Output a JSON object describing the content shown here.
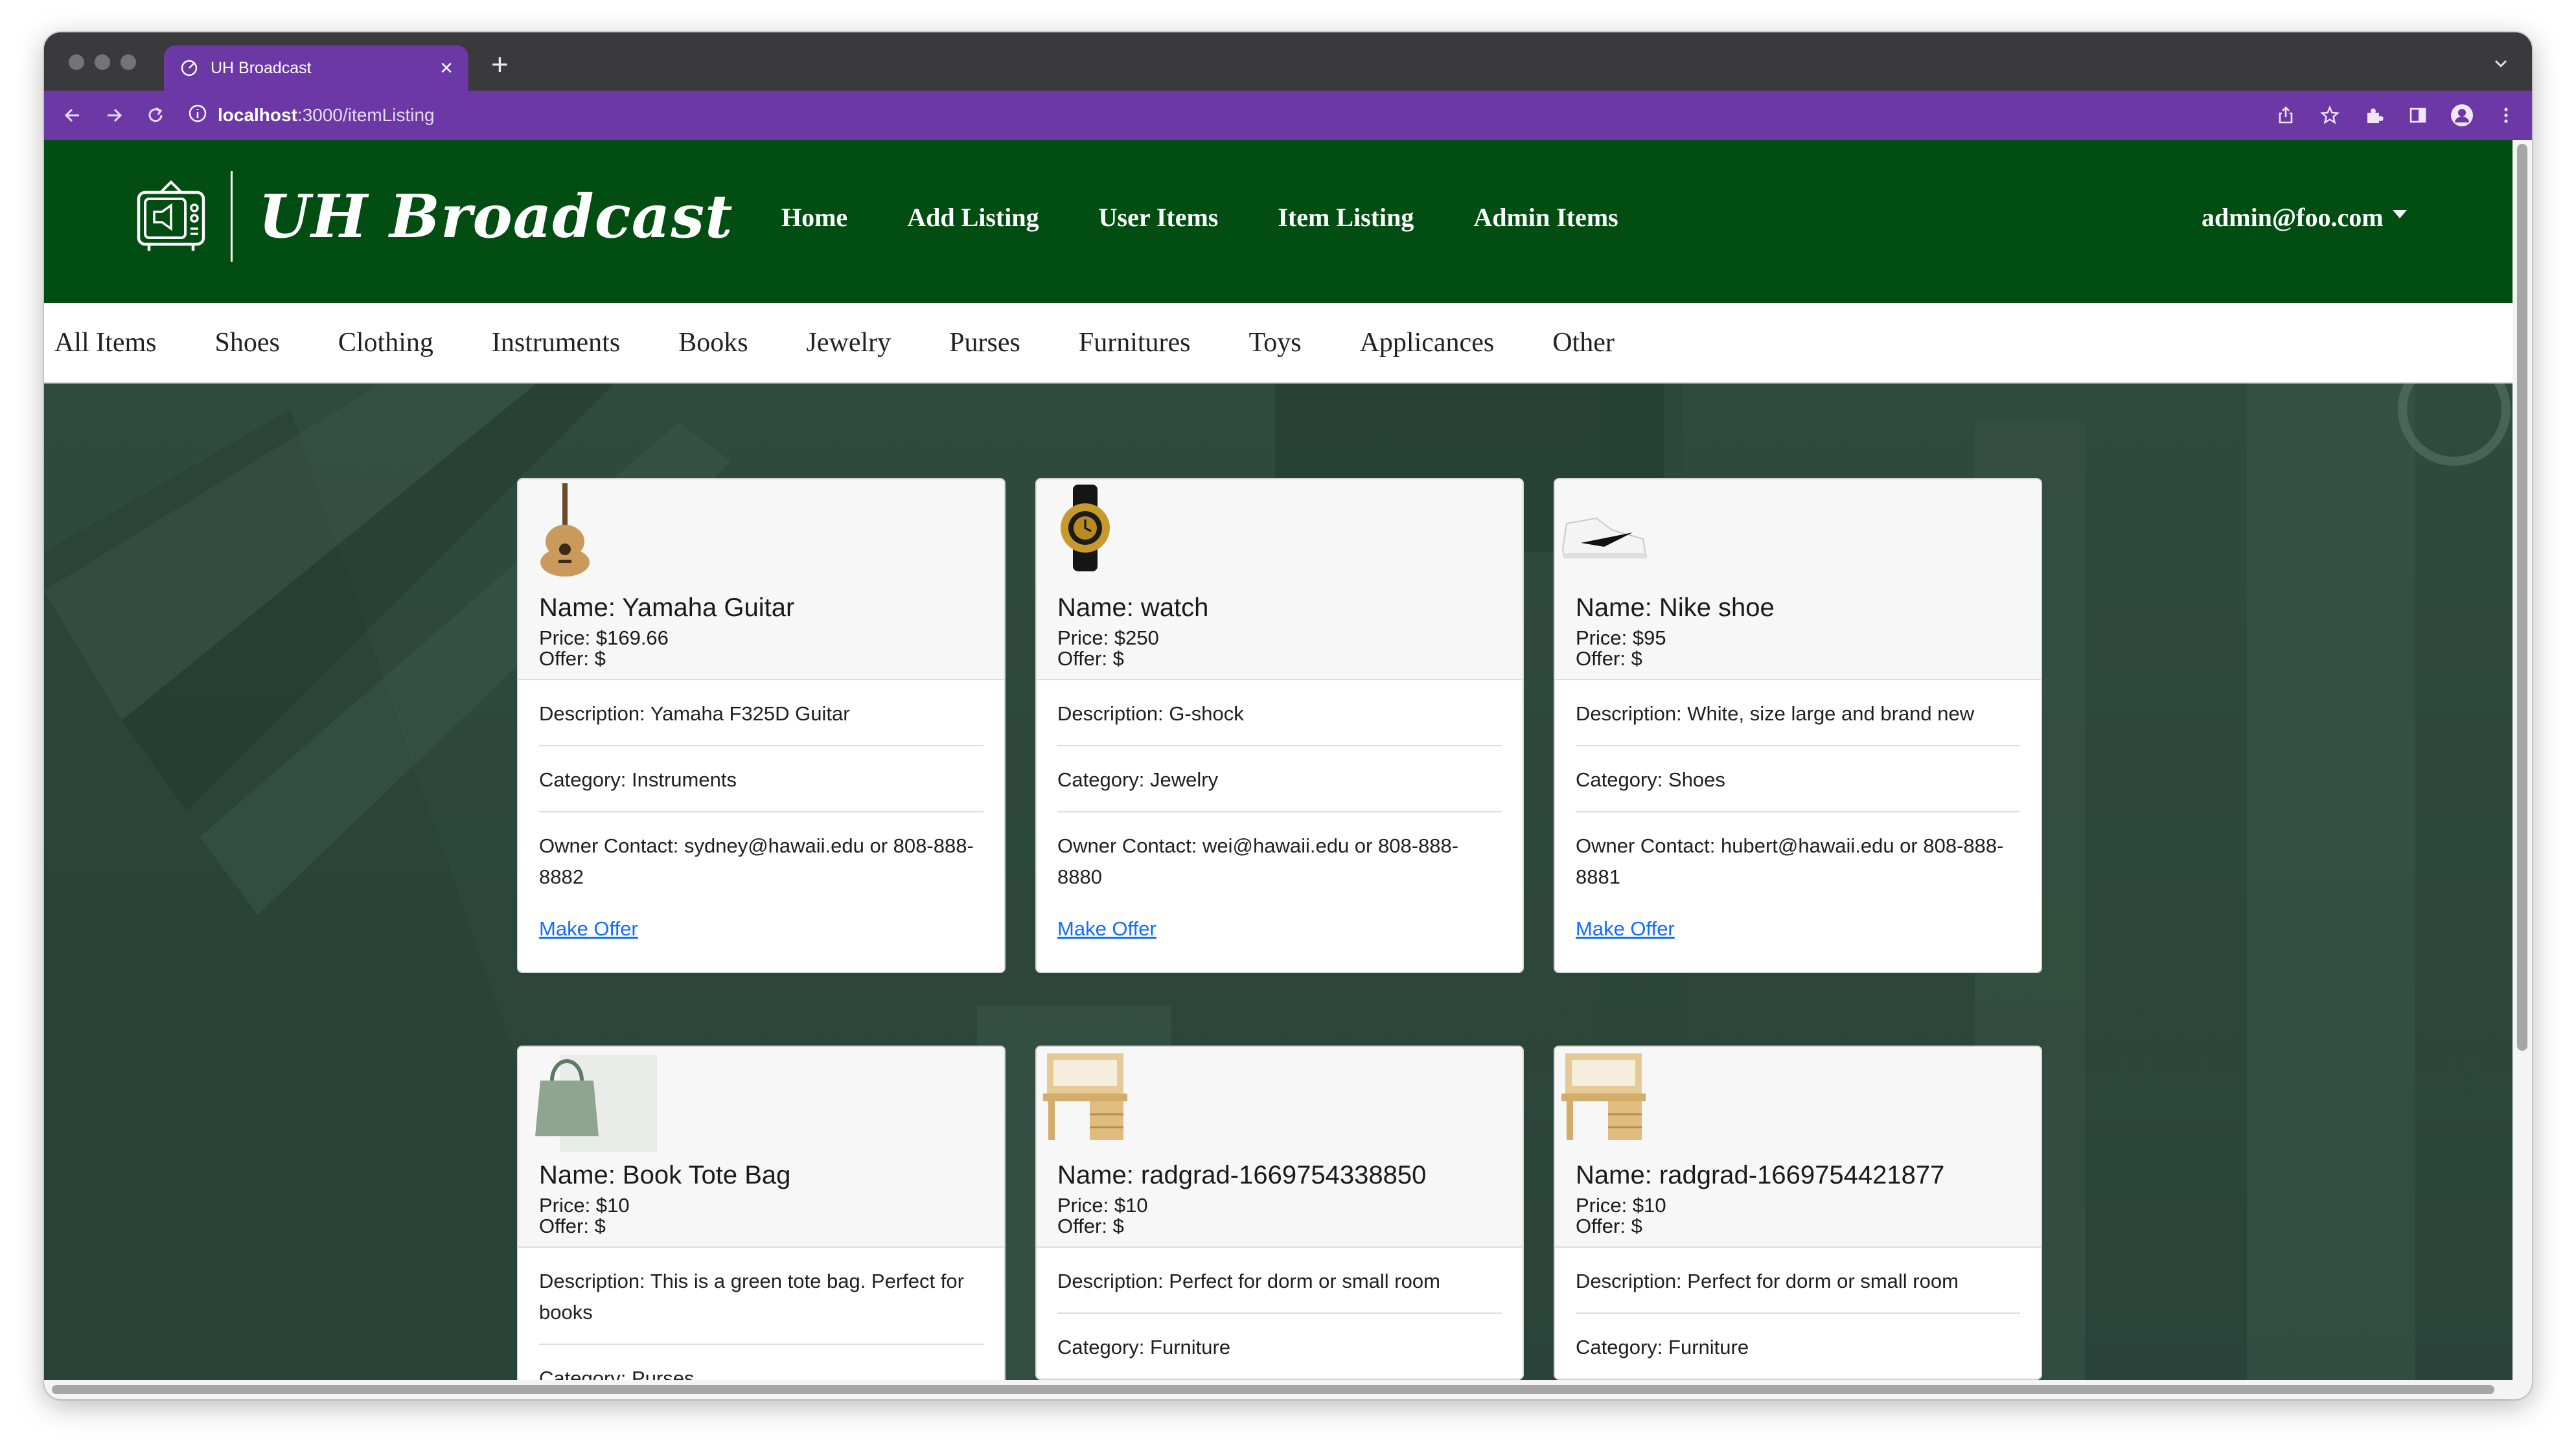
{
  "browser": {
    "tab_title": "UH Broadcast",
    "new_tab": "+",
    "close": "×",
    "url_host": "localhost",
    "url_path": ":3000/itemListing"
  },
  "navbar": {
    "brand": "UH Broadcast",
    "links": [
      "Home",
      "Add Listing",
      "User Items",
      "Item Listing",
      "Admin Items"
    ],
    "user": "admin@foo.com"
  },
  "categories": [
    "All Items",
    "Shoes",
    "Clothing",
    "Instruments",
    "Books",
    "Jewelry",
    "Purses",
    "Furnitures",
    "Toys",
    "Applicances",
    "Other"
  ],
  "items": [
    {
      "icon": "guitar-image",
      "name": "Name: Yamaha Guitar",
      "price": "Price: $169.66",
      "offer": "Offer: $",
      "description": "Description: Yamaha F325D Guitar",
      "category": "Category: Instruments",
      "contact": "Owner Contact: sydney@hawaii.edu or 808-888-8882",
      "action": "Make Offer"
    },
    {
      "icon": "watch-image",
      "name": "Name: watch",
      "price": "Price: $250",
      "offer": "Offer: $",
      "description": "Description: G-shock",
      "category": "Category: Jewelry",
      "contact": "Owner Contact: wei@hawaii.edu or 808-888-8880",
      "action": "Make Offer"
    },
    {
      "icon": "shoe-image",
      "name": "Name: Nike shoe",
      "price": "Price: $95",
      "offer": "Offer: $",
      "description": "Description: White, size large and brand new",
      "category": "Category: Shoes",
      "contact": "Owner Contact: hubert@hawaii.edu or 808-888-8881",
      "action": "Make Offer"
    },
    {
      "icon": "tote-bag-image",
      "name": "Name: Book Tote Bag",
      "price": "Price: $10",
      "offer": "Offer: $",
      "description": "Description: This is a green tote bag. Perfect for books",
      "category": "Category: Purses"
    },
    {
      "icon": "desk-image",
      "name": "Name: radgrad-1669754338850",
      "price": "Price: $10",
      "offer": "Offer: $",
      "description": "Description: Perfect for dorm or small room",
      "category": "Category: Furniture"
    },
    {
      "icon": "desk-image",
      "name": "Name: radgrad-1669754421877",
      "price": "Price: $10",
      "offer": "Offer: $",
      "description": "Description: Perfect for dorm or small room",
      "category": "Category: Furniture"
    }
  ]
}
